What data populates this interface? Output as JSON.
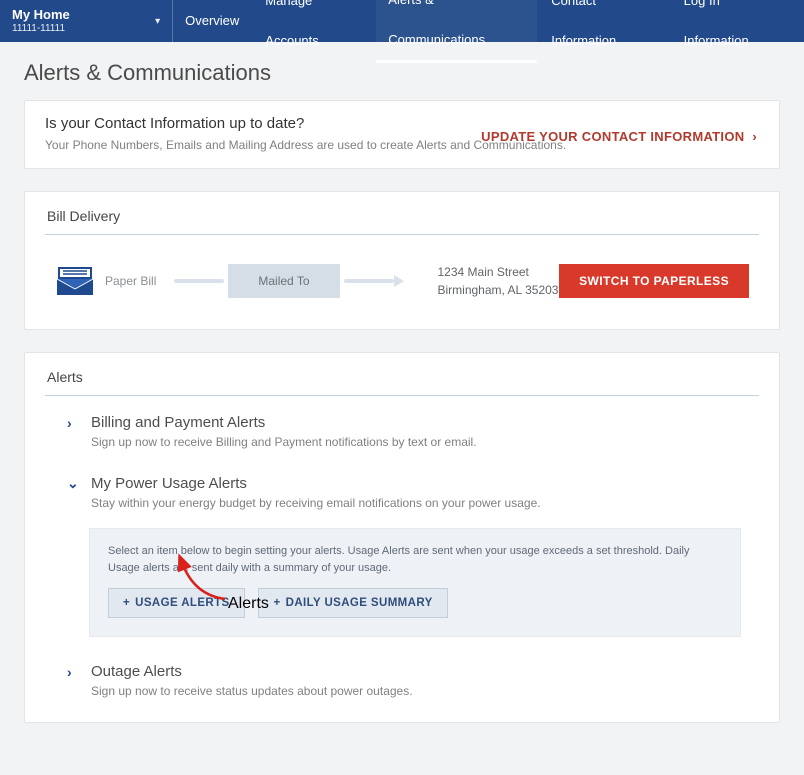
{
  "account": {
    "title": "My Home",
    "number": "11111-11111"
  },
  "nav": {
    "overview": "Overview",
    "manage": "Manage Accounts",
    "alerts": "Alerts & Communications",
    "contact": "Contact Information",
    "login": "Log In Information"
  },
  "page_title": "Alerts & Communications",
  "contact_panel": {
    "heading": "Is your Contact Information up to date?",
    "desc": "Your Phone Numbers, Emails and Mailing Address are used to create Alerts and Communications.",
    "cta": "UPDATE YOUR CONTACT INFORMATION"
  },
  "bill": {
    "heading": "Bill Delivery",
    "type": "Paper Bill",
    "mailed_to": "Mailed To",
    "addr1": "1234 Main Street",
    "addr2": "Birmingham, AL 35203",
    "switch": "SWITCH TO PAPERLESS"
  },
  "alerts": {
    "heading": "Alerts",
    "billing": {
      "title": "Billing and Payment Alerts",
      "desc": "Sign up now to receive Billing and Payment notifications by text or email."
    },
    "usage": {
      "title": "My Power Usage Alerts",
      "desc": "Stay within your energy budget by receiving email notifications on your power usage.",
      "note": "Select an item below to begin setting your alerts. Usage Alerts are sent when your usage exceeds a set threshold. Daily Usage alerts are sent daily with a summary of your usage.",
      "btn1": "USAGE ALERTS",
      "btn2": "DAILY USAGE SUMMARY"
    },
    "outage": {
      "title": "Outage Alerts",
      "desc": "Sign up now to receive status updates about power outages."
    }
  },
  "annotation": {
    "label": "Alerts"
  }
}
